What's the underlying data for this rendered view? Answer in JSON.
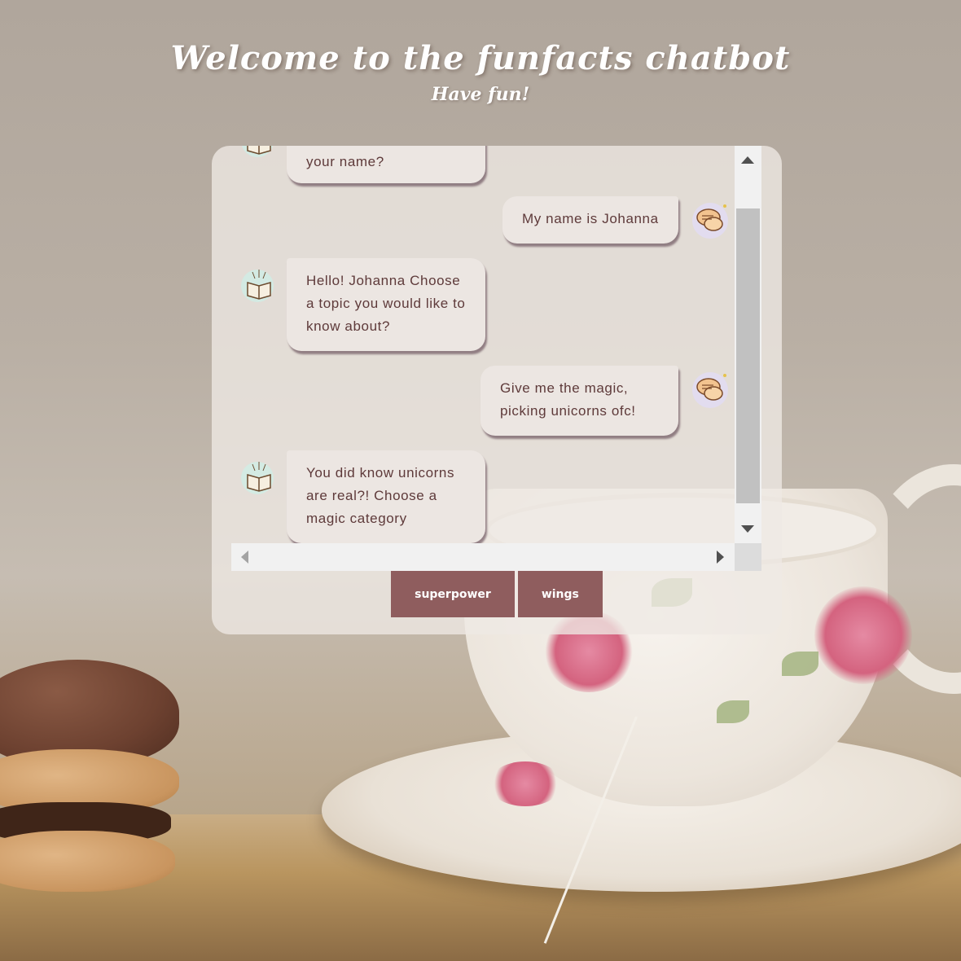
{
  "header": {
    "title": "Welcome to the funfacts chatbot",
    "subtitle": "Have fun!"
  },
  "chat": {
    "messages": [
      {
        "sender": "bot",
        "avatar_icon": "book-icon",
        "text": "your name?"
      },
      {
        "sender": "user",
        "avatar_icon": "chat-bubbles-icon",
        "text": "My name is Johanna"
      },
      {
        "sender": "bot",
        "avatar_icon": "book-icon",
        "text": "Hello! Johanna Choose a topic you would like to know about?"
      },
      {
        "sender": "user",
        "avatar_icon": "chat-bubbles-icon",
        "text": "Give me the magic, picking unicorns ofc!"
      },
      {
        "sender": "bot",
        "avatar_icon": "book-icon",
        "text": "You did know unicorns are real?! Choose a magic category"
      }
    ],
    "options": [
      {
        "label": "superpower"
      },
      {
        "label": "wings"
      }
    ]
  },
  "colors": {
    "button": "#8f5d5e",
    "bubble_text": "#5e3a3a",
    "bubble_bg": "#ece6e2"
  }
}
